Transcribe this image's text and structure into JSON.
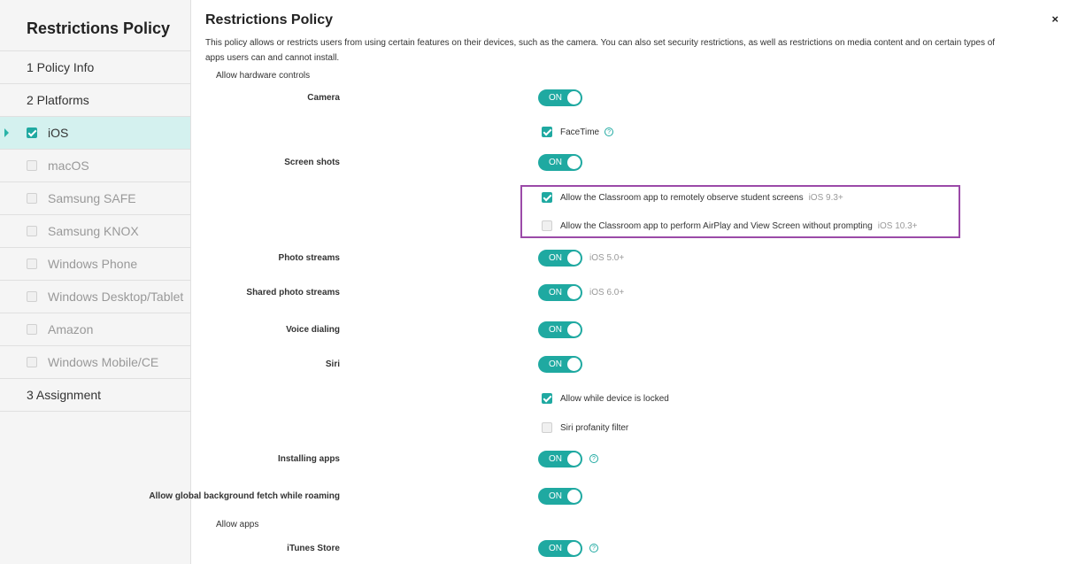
{
  "sidebar": {
    "title": "Restrictions Policy",
    "items": [
      {
        "label": "1  Policy Info"
      },
      {
        "label": "2  Platforms"
      },
      {
        "label": "iOS"
      },
      {
        "label": "macOS"
      },
      {
        "label": "Samsung SAFE"
      },
      {
        "label": "Samsung KNOX"
      },
      {
        "label": "Windows Phone"
      },
      {
        "label": "Windows Desktop/Tablet"
      },
      {
        "label": "Amazon"
      },
      {
        "label": "Windows Mobile/CE"
      },
      {
        "label": "3  Assignment"
      }
    ]
  },
  "main": {
    "title": "Restrictions Policy",
    "description": "This policy allows or restricts users from using certain features on their devices, such as the camera. You can also set security restrictions, as well as restrictions on media content and on certain types of apps users can and cannot install.",
    "close": "×",
    "section_hardware": "Allow hardware controls",
    "section_apps": "Allow apps",
    "toggle_on": "ON",
    "help": "?",
    "settings": {
      "camera": "Camera",
      "facetime": "FaceTime",
      "screenshots": "Screen shots",
      "classroom_observe": "Allow the Classroom app to remotely observe student screens",
      "classroom_observe_ver": "iOS 9.3+",
      "classroom_airplay": "Allow the Classroom app to perform AirPlay and View Screen without prompting",
      "classroom_airplay_ver": "iOS 10.3+",
      "photo_streams": "Photo streams",
      "photo_streams_ver": "iOS 5.0+",
      "shared_photo_streams": "Shared photo streams",
      "shared_photo_streams_ver": "iOS 6.0+",
      "voice_dialing": "Voice dialing",
      "siri": "Siri",
      "siri_locked": "Allow while device is locked",
      "siri_profanity": "Siri profanity filter",
      "installing_apps": "Installing apps",
      "bg_fetch": "Allow global background fetch while roaming",
      "itunes": "iTunes Store"
    }
  },
  "colors": {
    "accent": "#1fa9a1",
    "highlight": "#9b4aa8",
    "active_bg": "#d4f1ef"
  }
}
